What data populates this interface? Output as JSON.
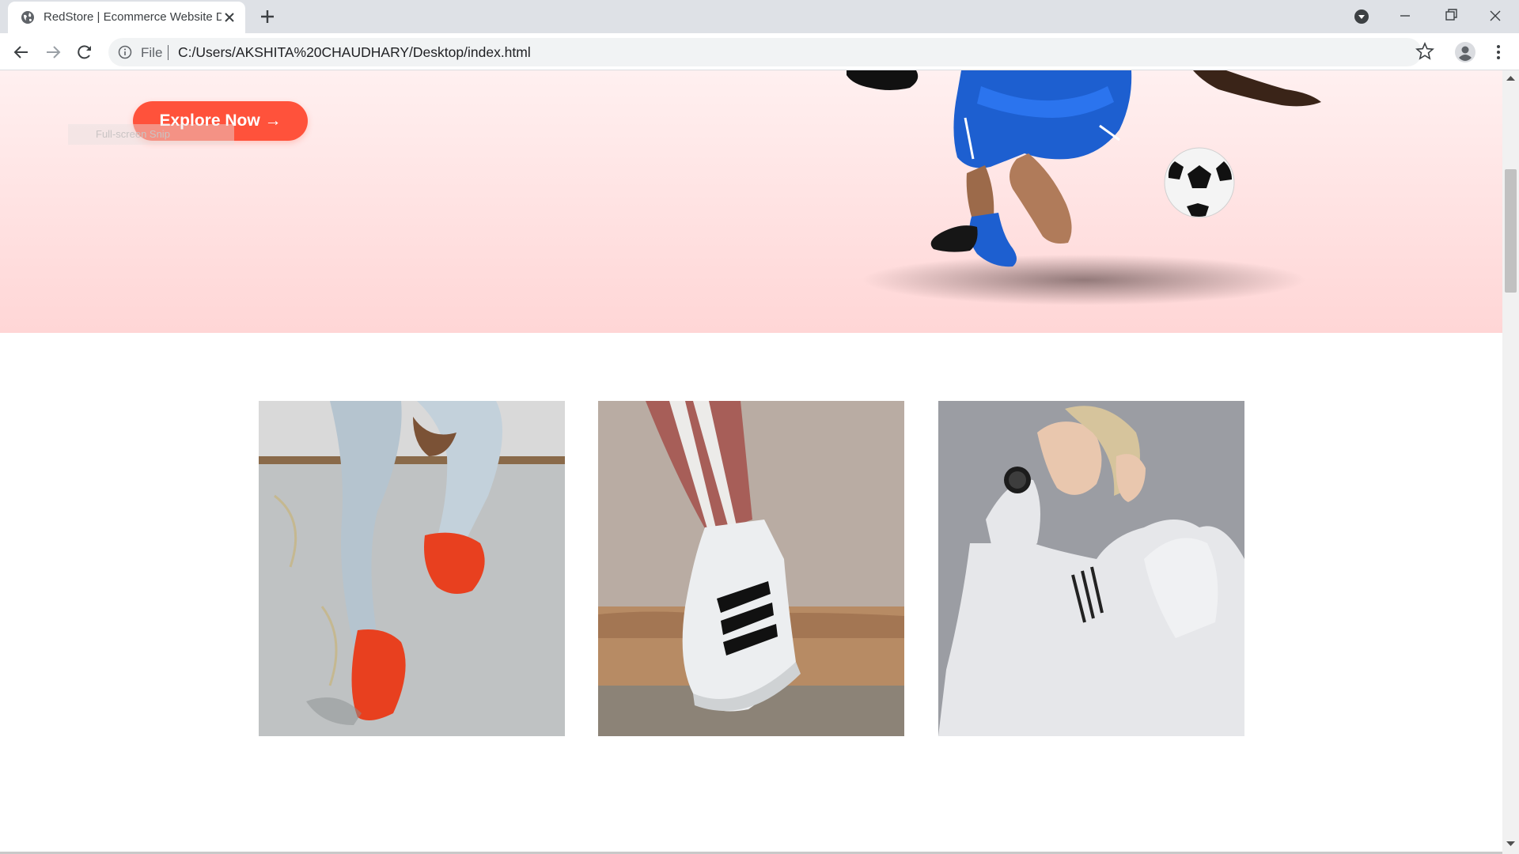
{
  "browser": {
    "tab_title": "RedStore | Ecommerce Website Design",
    "file_label": "File",
    "url": "C:/Users/AKSHITA%20CHAUDHARY/Desktop/index.html"
  },
  "hero": {
    "explore_button": "Explore Now →",
    "fullscreen_hint": "Full-screen Snip"
  },
  "offers": [
    {
      "subject": "red-sneakers-photo"
    },
    {
      "subject": "striped-sneaker-photo"
    },
    {
      "subject": "hoodie-smartwatch-photo"
    }
  ],
  "colors": {
    "accent": "#ff523b",
    "hero_bg_top": "#fff0f0",
    "hero_bg_bottom": "#ffd6d6",
    "tabbar": "#dee1e6"
  },
  "icons": [
    "globe-icon",
    "close-icon",
    "plus-icon",
    "tab-search-icon",
    "minimize-icon",
    "maximize-icon",
    "window-close-icon",
    "back-icon",
    "forward-icon",
    "reload-icon",
    "info-icon",
    "star-icon",
    "profile-icon",
    "menu-icon"
  ]
}
